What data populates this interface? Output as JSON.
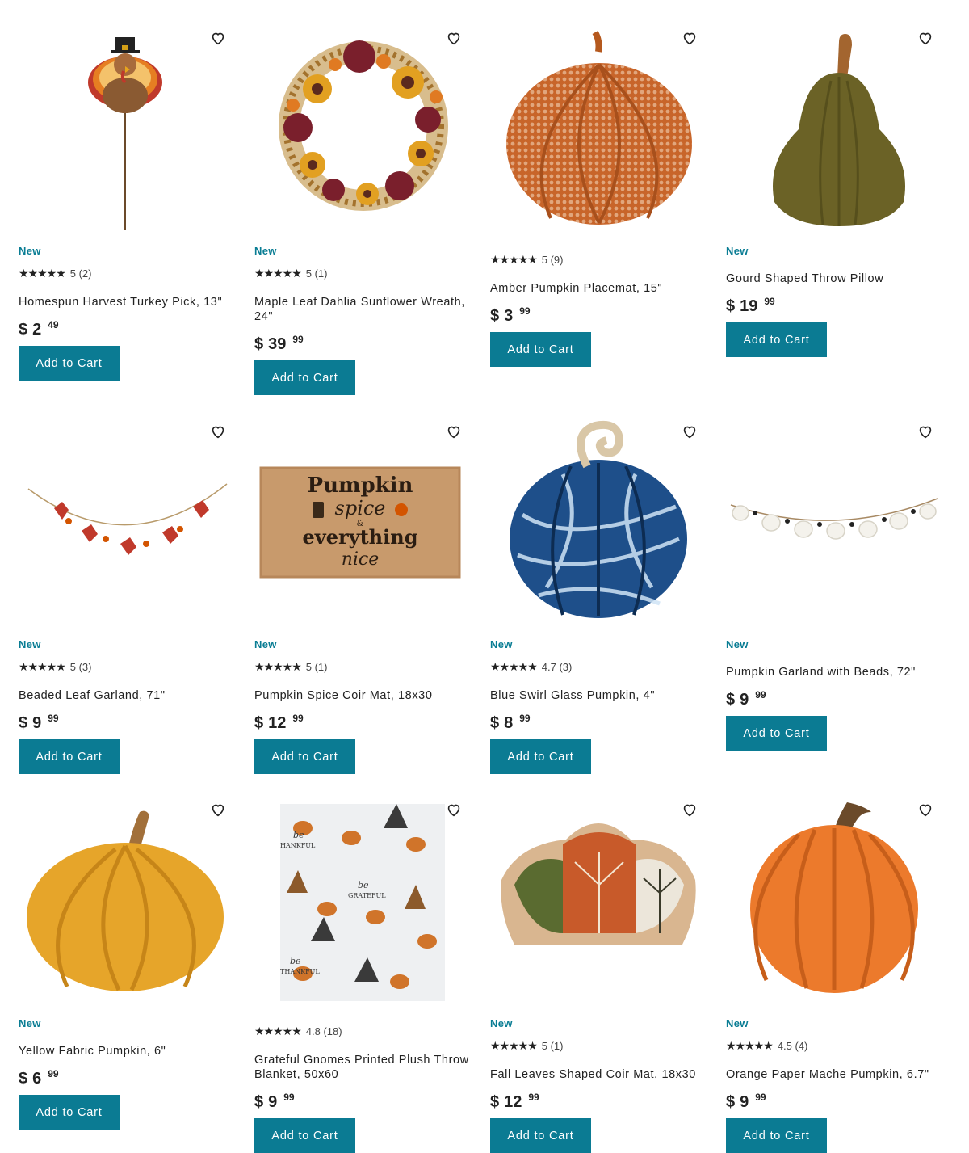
{
  "colors": {
    "accent": "#0b7b93",
    "badge": "#0a7d94"
  },
  "products": [
    {
      "badge": "New",
      "stars": "★★★★★",
      "rating": "5 (2)",
      "title": "Homespun Harvest Turkey Pick, 13\"",
      "currency": "$",
      "dollars": "2",
      "cents": "49",
      "button": "Add to Cart",
      "image": "turkey-pick"
    },
    {
      "badge": "New",
      "stars": "★★★★★",
      "rating": "5 (1)",
      "title": "Maple Leaf Dahlia Sunflower Wreath, 24\"",
      "currency": "$",
      "dollars": "39",
      "cents": "99",
      "button": "Add to Cart",
      "image": "wreath"
    },
    {
      "badge": "",
      "stars": "★★★★★",
      "rating": "5 (9)",
      "title": "Amber Pumpkin Placemat, 15\"",
      "currency": "$",
      "dollars": "3",
      "cents": "99",
      "button": "Add to Cart",
      "image": "pumpkin-placemat"
    },
    {
      "badge": "New",
      "stars": "",
      "rating": "",
      "title": "Gourd Shaped Throw Pillow",
      "currency": "$",
      "dollars": "19",
      "cents": "99",
      "button": "Add to Cart",
      "image": "gourd-pillow"
    },
    {
      "badge": "New",
      "stars": "★★★★★",
      "rating": "5 (3)",
      "title": "Beaded Leaf Garland, 71\"",
      "currency": "$",
      "dollars": "9",
      "cents": "99",
      "button": "Add to Cart",
      "image": "leaf-garland"
    },
    {
      "badge": "New",
      "stars": "★★★★★",
      "rating": "5 (1)",
      "title": "Pumpkin Spice Coir Mat, 18x30",
      "currency": "$",
      "dollars": "12",
      "cents": "99",
      "button": "Add to Cart",
      "image": "coir-mat",
      "mat_text": [
        "Pumpkin",
        "spice",
        "&",
        "everything",
        "nice"
      ]
    },
    {
      "badge": "New",
      "stars": "★★★★★",
      "rating": "4.7 (3)",
      "title": "Blue Swirl Glass Pumpkin, 4\"",
      "currency": "$",
      "dollars": "8",
      "cents": "99",
      "button": "Add to Cart",
      "image": "glass-pumpkin"
    },
    {
      "badge": "New",
      "stars": "",
      "rating": "",
      "title": "Pumpkin Garland with Beads, 72\"",
      "currency": "$",
      "dollars": "9",
      "cents": "99",
      "button": "Add to Cart",
      "image": "pumpkin-garland"
    },
    {
      "badge": "New",
      "stars": "",
      "rating": "",
      "title": "Yellow Fabric Pumpkin, 6\"",
      "currency": "$",
      "dollars": "6",
      "cents": "99",
      "button": "Add to Cart",
      "image": "fabric-pumpkin"
    },
    {
      "badge": "",
      "stars": "★★★★★",
      "rating": "4.8 (18)",
      "title": "Grateful Gnomes Printed Plush Throw Blanket, 50x60",
      "currency": "$",
      "dollars": "9",
      "cents": "99",
      "button": "Add to Cart",
      "image": "gnome-blanket",
      "blanket_text": [
        "be",
        "HANKFUL",
        "be",
        "GRATEFUL",
        "be",
        "THANKFUL"
      ]
    },
    {
      "badge": "New",
      "stars": "★★★★★",
      "rating": "5 (1)",
      "title": "Fall Leaves Shaped Coir Mat, 18x30",
      "currency": "$",
      "dollars": "12",
      "cents": "99",
      "button": "Add to Cart",
      "image": "leaves-mat"
    },
    {
      "badge": "New",
      "stars": "★★★★★",
      "rating": "4.5 (4)",
      "title": "Orange Paper Mache Pumpkin, 6.7\"",
      "currency": "$",
      "dollars": "9",
      "cents": "99",
      "button": "Add to Cart",
      "image": "paper-mache-pumpkin"
    }
  ]
}
